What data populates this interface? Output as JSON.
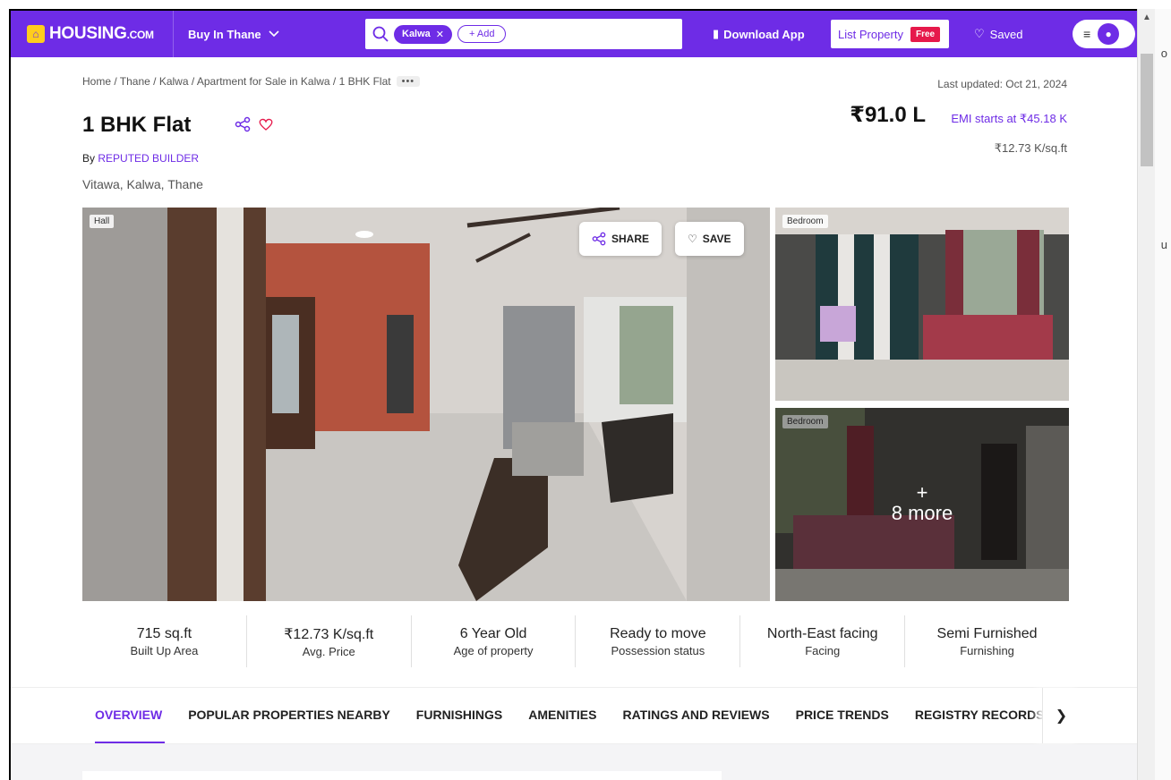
{
  "header": {
    "logo_text": "HOUSING",
    "logo_suffix": ".COM",
    "buy_in": "Buy In Thane",
    "search_chip": "Kalwa",
    "search_add": "+ Add",
    "download_app": "Download App",
    "list_property": "List Property",
    "free_badge": "Free",
    "saved": "Saved",
    "brand_color": "#6e2ce6"
  },
  "breadcrumb": "Home / Thane / Kalwa / Apartment for Sale in Kalwa / 1 BHK Flat",
  "last_updated": "Last updated: Oct 21, 2024",
  "listing": {
    "title": "1 BHK Flat",
    "price": "₹91.0 L",
    "emi": "EMI starts at ₹45.18 K",
    "per_sqft": "₹12.73 K/sq.ft",
    "by_label": "By",
    "builder": "REPUTED BUILDER",
    "locality": "Vitawa, Kalwa, Thane"
  },
  "gallery": {
    "main_tag": "Hall",
    "share": "SHARE",
    "save": "SAVE",
    "side1_tag": "Bedroom",
    "side2_tag": "Bedroom",
    "more_plus": "+",
    "more_text": "8 more"
  },
  "stats": [
    {
      "value": "715 sq.ft",
      "label": "Built Up Area"
    },
    {
      "value": "₹12.73 K/sq.ft",
      "label": "Avg. Price"
    },
    {
      "value": "6 Year Old",
      "label": "Age of property"
    },
    {
      "value": "Ready to move",
      "label": "Possession status"
    },
    {
      "value": "North-East facing",
      "label": "Facing"
    },
    {
      "value": "Semi Furnished",
      "label": "Furnishing"
    }
  ],
  "tabs": [
    "OVERVIEW",
    "POPULAR PROPERTIES NEARBY",
    "FURNISHINGS",
    "AMENITIES",
    "RATINGS AND REVIEWS",
    "PRICE TRENDS",
    "REGISTRY RECORDS"
  ],
  "edge_chars": [
    "o",
    "u"
  ]
}
